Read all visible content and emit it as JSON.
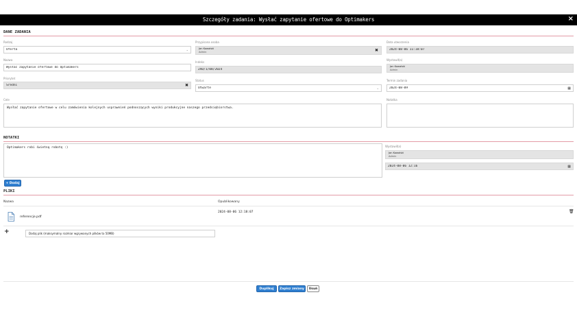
{
  "modal": {
    "title": "Szczegóły zadania: Wysłać zapytanie ofertowe do Optimakers",
    "close_icon": "×"
  },
  "details": {
    "section_title": "DANE ZADANIA",
    "type": {
      "label": "Rodzaj",
      "value": "Oferta"
    },
    "name": {
      "label": "Nazwa",
      "value": "Wysłać zapytanie ofertowe do Optimakers"
    },
    "priority": {
      "label": "Priorytet",
      "value": "Średni"
    },
    "assignee": {
      "label": "Przypisana osoba",
      "name": "Jan Kowalski",
      "role": "Admin"
    },
    "index": {
      "label": "Indeks",
      "value": "ZAD/1/08/2024"
    },
    "status": {
      "label": "Status",
      "value": "Otwarte"
    },
    "created": {
      "label": "Data utworzenia",
      "value": "2024-08-06 11:18:07"
    },
    "issued_by": {
      "label": "Wystawił(a)",
      "name": "Jan Kowalski",
      "role": "Admin"
    },
    "deadline": {
      "label": "Termin zadania",
      "value": "2024-08-09"
    },
    "goal": {
      "label": "Cele",
      "value": "Wysłać zapytanie ofertowe w celu zamówienia kolejnych usprawnień podnoszących wyniki produkcyjne naszego przedsiębiorstwa."
    },
    "note": {
      "label": "Notatka",
      "value": ""
    }
  },
  "notes": {
    "section_title": "NOTATKI",
    "text": "Optimakers robi świetną robotę :)",
    "issued_label": "Wystawił(a)",
    "author_name": "Jan Kowalski",
    "author_role": "Admin",
    "date": "2024-08-06 12:16",
    "add_button": "+ Dodaj"
  },
  "files": {
    "section_title": "PLIKI",
    "col_name": "Nazwa",
    "col_published": "Opublikowany",
    "rows": [
      {
        "name": "referencje.pdf",
        "published": "2024-08-06 12:18:07"
      }
    ],
    "upload_label": "Dodaj plik (maksymalny rozmiar wgrywanych plików to 50MB)"
  },
  "footer": {
    "duplicate": "Duplikuj",
    "save": "Zapisz zmiany",
    "delete": "Usuń"
  }
}
